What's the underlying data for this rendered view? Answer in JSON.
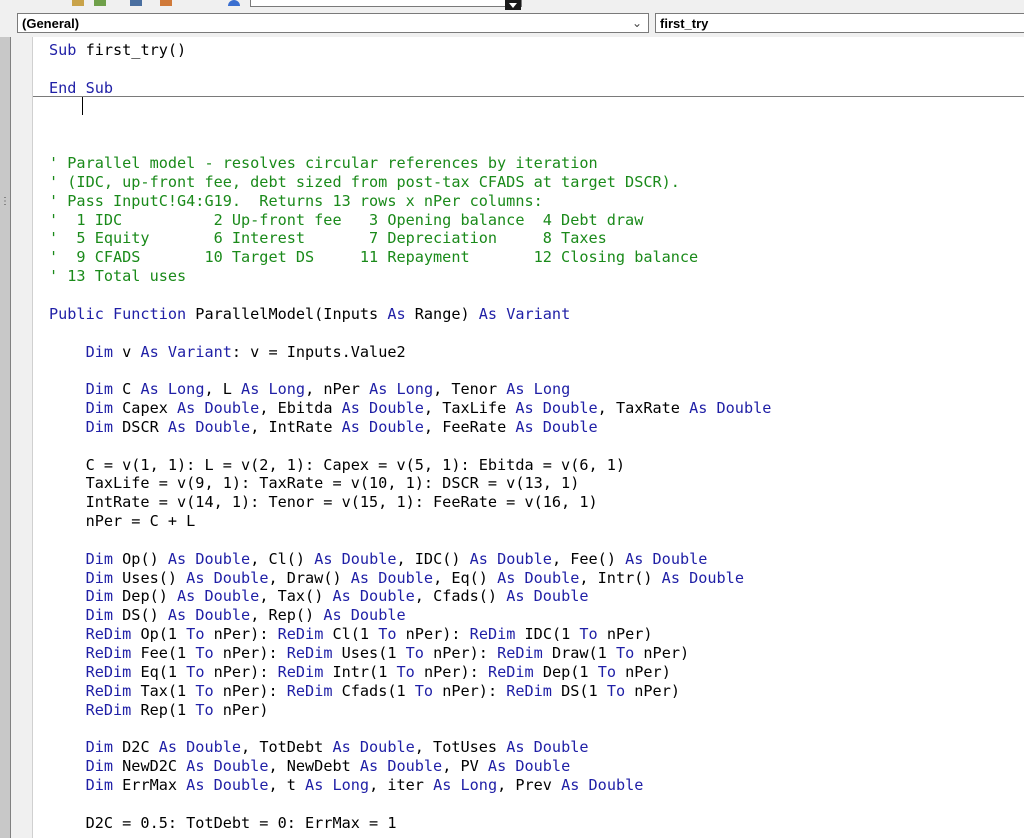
{
  "topbar": {
    "procedure_combo": "(General)",
    "proc_combo": "first_try"
  },
  "code": {
    "lines": [
      [
        [
          "kw",
          "Sub"
        ],
        [
          "t",
          " first_try()"
        ]
      ],
      [],
      [
        [
          "kw",
          "End Sub"
        ]
      ],
      [],
      [],
      [],
      [
        [
          "cm",
          "' Parallel model - resolves circular references by iteration"
        ]
      ],
      [
        [
          "cm",
          "' (IDC, up-front fee, debt sized from post-tax CFADS at target DSCR)."
        ]
      ],
      [
        [
          "cm",
          "' Pass InputC!G4:G19.  Returns 13 rows x nPer columns:"
        ]
      ],
      [
        [
          "cm",
          "'  1 IDC          2 Up-front fee   3 Opening balance  4 Debt draw"
        ]
      ],
      [
        [
          "cm",
          "'  5 Equity       6 Interest       7 Depreciation     8 Taxes"
        ]
      ],
      [
        [
          "cm",
          "'  9 CFADS       10 Target DS     11 Repayment       12 Closing balance"
        ]
      ],
      [
        [
          "cm",
          "' 13 Total uses"
        ]
      ],
      [],
      [
        [
          "kw",
          "Public Function"
        ],
        [
          "t",
          " ParallelModel(Inputs "
        ],
        [
          "kw",
          "As"
        ],
        [
          "t",
          " Range) "
        ],
        [
          "kw",
          "As Variant"
        ]
      ],
      [],
      [
        [
          "t",
          "    "
        ],
        [
          "kw",
          "Dim"
        ],
        [
          "t",
          " v "
        ],
        [
          "kw",
          "As Variant"
        ],
        [
          "t",
          ": v = Inputs.Value2"
        ]
      ],
      [],
      [
        [
          "t",
          "    "
        ],
        [
          "kw",
          "Dim"
        ],
        [
          "t",
          " C "
        ],
        [
          "kw",
          "As Long"
        ],
        [
          "t",
          ", L "
        ],
        [
          "kw",
          "As Long"
        ],
        [
          "t",
          ", nPer "
        ],
        [
          "kw",
          "As Long"
        ],
        [
          "t",
          ", Tenor "
        ],
        [
          "kw",
          "As Long"
        ]
      ],
      [
        [
          "t",
          "    "
        ],
        [
          "kw",
          "Dim"
        ],
        [
          "t",
          " Capex "
        ],
        [
          "kw",
          "As Double"
        ],
        [
          "t",
          ", Ebitda "
        ],
        [
          "kw",
          "As Double"
        ],
        [
          "t",
          ", TaxLife "
        ],
        [
          "kw",
          "As Double"
        ],
        [
          "t",
          ", TaxRate "
        ],
        [
          "kw",
          "As Double"
        ]
      ],
      [
        [
          "t",
          "    "
        ],
        [
          "kw",
          "Dim"
        ],
        [
          "t",
          " DSCR "
        ],
        [
          "kw",
          "As Double"
        ],
        [
          "t",
          ", IntRate "
        ],
        [
          "kw",
          "As Double"
        ],
        [
          "t",
          ", FeeRate "
        ],
        [
          "kw",
          "As Double"
        ]
      ],
      [],
      [
        [
          "t",
          "    C = v(1, 1): L = v(2, 1): Capex = v(5, 1): Ebitda = v(6, 1)"
        ]
      ],
      [
        [
          "t",
          "    TaxLife = v(9, 1): TaxRate = v(10, 1): DSCR = v(13, 1)"
        ]
      ],
      [
        [
          "t",
          "    IntRate = v(14, 1): Tenor = v(15, 1): FeeRate = v(16, 1)"
        ]
      ],
      [
        [
          "t",
          "    nPer = C + L"
        ]
      ],
      [],
      [
        [
          "t",
          "    "
        ],
        [
          "kw",
          "Dim"
        ],
        [
          "t",
          " Op() "
        ],
        [
          "kw",
          "As Double"
        ],
        [
          "t",
          ", Cl() "
        ],
        [
          "kw",
          "As Double"
        ],
        [
          "t",
          ", IDC() "
        ],
        [
          "kw",
          "As Double"
        ],
        [
          "t",
          ", Fee() "
        ],
        [
          "kw",
          "As Double"
        ]
      ],
      [
        [
          "t",
          "    "
        ],
        [
          "kw",
          "Dim"
        ],
        [
          "t",
          " Uses() "
        ],
        [
          "kw",
          "As Double"
        ],
        [
          "t",
          ", Draw() "
        ],
        [
          "kw",
          "As Double"
        ],
        [
          "t",
          ", Eq() "
        ],
        [
          "kw",
          "As Double"
        ],
        [
          "t",
          ", Intr() "
        ],
        [
          "kw",
          "As Double"
        ]
      ],
      [
        [
          "t",
          "    "
        ],
        [
          "kw",
          "Dim"
        ],
        [
          "t",
          " Dep() "
        ],
        [
          "kw",
          "As Double"
        ],
        [
          "t",
          ", Tax() "
        ],
        [
          "kw",
          "As Double"
        ],
        [
          "t",
          ", Cfads() "
        ],
        [
          "kw",
          "As Double"
        ]
      ],
      [
        [
          "t",
          "    "
        ],
        [
          "kw",
          "Dim"
        ],
        [
          "t",
          " DS() "
        ],
        [
          "kw",
          "As Double"
        ],
        [
          "t",
          ", Rep() "
        ],
        [
          "kw",
          "As Double"
        ]
      ],
      [
        [
          "t",
          "    "
        ],
        [
          "kw",
          "ReDim"
        ],
        [
          "t",
          " Op(1 "
        ],
        [
          "kw",
          "To"
        ],
        [
          "t",
          " nPer): "
        ],
        [
          "kw",
          "ReDim"
        ],
        [
          "t",
          " Cl(1 "
        ],
        [
          "kw",
          "To"
        ],
        [
          "t",
          " nPer): "
        ],
        [
          "kw",
          "ReDim"
        ],
        [
          "t",
          " IDC(1 "
        ],
        [
          "kw",
          "To"
        ],
        [
          "t",
          " nPer)"
        ]
      ],
      [
        [
          "t",
          "    "
        ],
        [
          "kw",
          "ReDim"
        ],
        [
          "t",
          " Fee(1 "
        ],
        [
          "kw",
          "To"
        ],
        [
          "t",
          " nPer): "
        ],
        [
          "kw",
          "ReDim"
        ],
        [
          "t",
          " Uses(1 "
        ],
        [
          "kw",
          "To"
        ],
        [
          "t",
          " nPer): "
        ],
        [
          "kw",
          "ReDim"
        ],
        [
          "t",
          " Draw(1 "
        ],
        [
          "kw",
          "To"
        ],
        [
          "t",
          " nPer)"
        ]
      ],
      [
        [
          "t",
          "    "
        ],
        [
          "kw",
          "ReDim"
        ],
        [
          "t",
          " Eq(1 "
        ],
        [
          "kw",
          "To"
        ],
        [
          "t",
          " nPer): "
        ],
        [
          "kw",
          "ReDim"
        ],
        [
          "t",
          " Intr(1 "
        ],
        [
          "kw",
          "To"
        ],
        [
          "t",
          " nPer): "
        ],
        [
          "kw",
          "ReDim"
        ],
        [
          "t",
          " Dep(1 "
        ],
        [
          "kw",
          "To"
        ],
        [
          "t",
          " nPer)"
        ]
      ],
      [
        [
          "t",
          "    "
        ],
        [
          "kw",
          "ReDim"
        ],
        [
          "t",
          " Tax(1 "
        ],
        [
          "kw",
          "To"
        ],
        [
          "t",
          " nPer): "
        ],
        [
          "kw",
          "ReDim"
        ],
        [
          "t",
          " Cfads(1 "
        ],
        [
          "kw",
          "To"
        ],
        [
          "t",
          " nPer): "
        ],
        [
          "kw",
          "ReDim"
        ],
        [
          "t",
          " DS(1 "
        ],
        [
          "kw",
          "To"
        ],
        [
          "t",
          " nPer)"
        ]
      ],
      [
        [
          "t",
          "    "
        ],
        [
          "kw",
          "ReDim"
        ],
        [
          "t",
          " Rep(1 "
        ],
        [
          "kw",
          "To"
        ],
        [
          "t",
          " nPer)"
        ]
      ],
      [],
      [
        [
          "t",
          "    "
        ],
        [
          "kw",
          "Dim"
        ],
        [
          "t",
          " D2C "
        ],
        [
          "kw",
          "As Double"
        ],
        [
          "t",
          ", TotDebt "
        ],
        [
          "kw",
          "As Double"
        ],
        [
          "t",
          ", TotUses "
        ],
        [
          "kw",
          "As Double"
        ]
      ],
      [
        [
          "t",
          "    "
        ],
        [
          "kw",
          "Dim"
        ],
        [
          "t",
          " NewD2C "
        ],
        [
          "kw",
          "As Double"
        ],
        [
          "t",
          ", NewDebt "
        ],
        [
          "kw",
          "As Double"
        ],
        [
          "t",
          ", PV "
        ],
        [
          "kw",
          "As Double"
        ]
      ],
      [
        [
          "t",
          "    "
        ],
        [
          "kw",
          "Dim"
        ],
        [
          "t",
          " ErrMax "
        ],
        [
          "kw",
          "As Double"
        ],
        [
          "t",
          ", t "
        ],
        [
          "kw",
          "As Long"
        ],
        [
          "t",
          ", iter "
        ],
        [
          "kw",
          "As Long"
        ],
        [
          "t",
          ", Prev "
        ],
        [
          "kw",
          "As Double"
        ]
      ],
      [],
      [
        [
          "t",
          "    D2C = 0.5: TotDebt = 0: ErrMax = 1"
        ]
      ]
    ]
  }
}
